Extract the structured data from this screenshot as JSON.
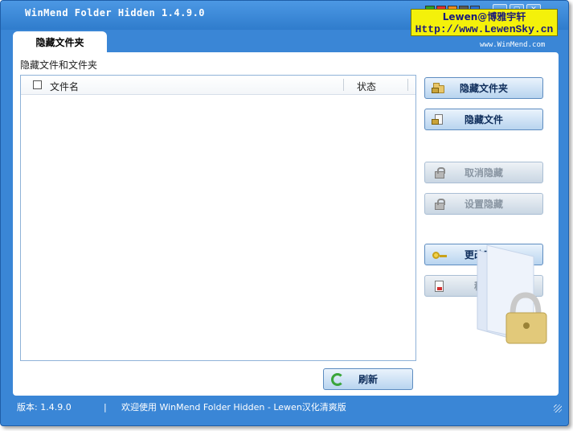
{
  "window": {
    "title": "WinMend Folder Hidden 1.4.9.0",
    "minimize_glyph": "—",
    "close_glyph": "✕",
    "skin_colors": [
      "#27a127",
      "#e03030",
      "#f08a1a",
      "#5a5a5a",
      "#2a6fd0"
    ]
  },
  "credit": {
    "line1": "Lewen@博雅宇轩",
    "line2": "Http://www.LewenSky.cn"
  },
  "tab": {
    "label": "隐藏文件夹"
  },
  "website": "www.WinMend.com",
  "section_label": "隐藏文件和文件夹",
  "table": {
    "columns": {
      "name": "文件名",
      "status": "状态"
    },
    "rows": []
  },
  "buttons": {
    "hide_folder": "隐藏文件夹",
    "hide_file": "隐藏文件",
    "unhide": "取消隐藏",
    "set_hide": "设置隐藏",
    "change_password": "更改密码",
    "remove": "移除",
    "refresh": "刷新"
  },
  "status": {
    "version": "版本: 1.4.9.0",
    "separator": "|",
    "message": "欢迎使用 WinMend Folder Hidden - Lewen汉化清爽版"
  },
  "colors": {
    "window_blue": "#3a86d6",
    "credit_yellow": "#f4f10a",
    "button_text": "#0f2e5c"
  }
}
